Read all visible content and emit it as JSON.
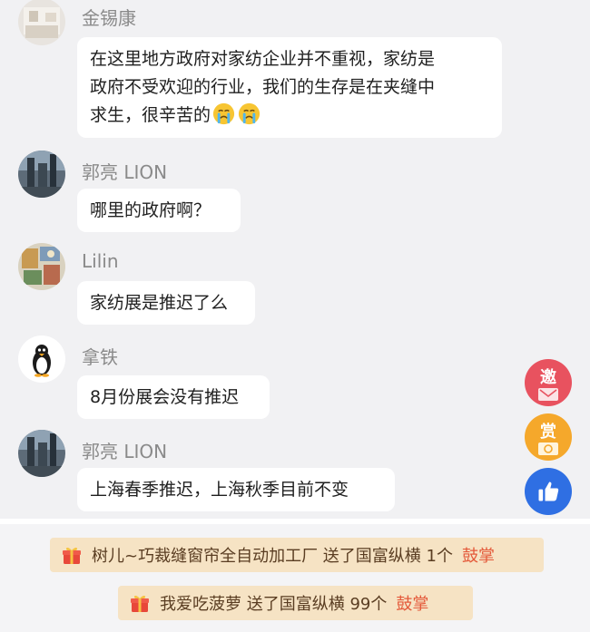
{
  "messages": [
    {
      "user": "金锡康",
      "avatar": "avatar-jinxikang",
      "lines": [
        "在这里地方政府对家纺企业并不重视，家纺是",
        "政府不受欢迎的行业，我们的生存是在夹缝中",
        "求生，很辛苦的"
      ],
      "emojis": [
        "crying-face-icon",
        "crying-face-icon"
      ]
    },
    {
      "user": "郭亮 LION",
      "avatar": "avatar-guoliang",
      "lines": [
        "哪里的政府啊？"
      ]
    },
    {
      "user": "Lilin",
      "avatar": "avatar-lilin",
      "lines": [
        "家纺展是推迟了么"
      ]
    },
    {
      "user": "拿铁",
      "avatar": "avatar-natie-penguin",
      "lines": [
        "8月份展会没有推迟"
      ]
    },
    {
      "user": "郭亮 LION",
      "avatar": "avatar-guoliang",
      "lines": [
        "上海春季推迟，上海秋季目前不变"
      ]
    }
  ],
  "floating_buttons": {
    "invite": {
      "label": "邀",
      "color": "#e8525f",
      "icon": "invite-envelope-icon"
    },
    "reward": {
      "label": "赏",
      "color": "#f5a82b",
      "icon": "reward-coin-icon"
    },
    "like": {
      "color": "#2f6fe3",
      "icon": "thumbs-up-icon"
    }
  },
  "gifts": [
    {
      "text": "树儿~巧裁缝窗帘全自动加工厂 送了国富纵横 1个",
      "action": "鼓掌",
      "icon": "gift-box-icon"
    },
    {
      "text": "我爱吃菠萝 送了国富纵横 99个",
      "action": "鼓掌",
      "icon": "gift-box-icon"
    }
  ],
  "colors": {
    "background": "#f1f1f3",
    "bubble": "#ffffff",
    "gift_bar": "#f6e3c4",
    "clap": "#e45a3b"
  }
}
